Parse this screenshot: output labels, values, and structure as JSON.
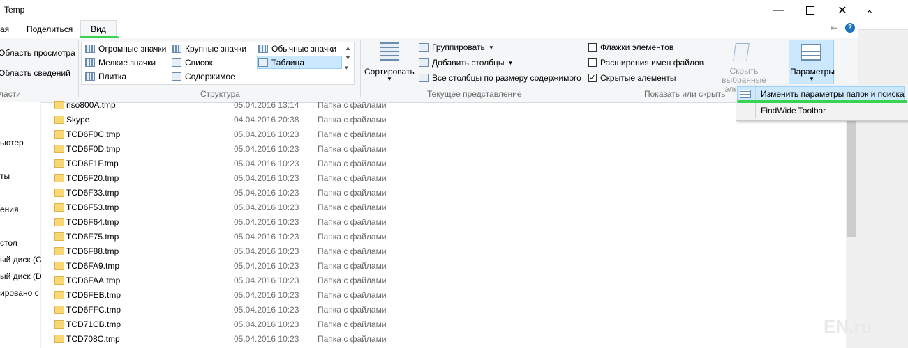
{
  "window": {
    "title": "Temp"
  },
  "tabs": {
    "left_partial": "ая",
    "share": "Поделиться",
    "view": "Вид"
  },
  "ribbon": {
    "panes": {
      "preview": "Область просмотра",
      "details": "Область сведений",
      "label": "ласти"
    },
    "layout": {
      "items": [
        "Огромные значки",
        "Крупные значки",
        "Обычные значки",
        "Мелкие значки",
        "Список",
        "Таблица",
        "Плитка",
        "Содержимое"
      ],
      "selected": "Таблица",
      "label": "Структура"
    },
    "current_view": {
      "sort": "Сортировать",
      "group": "Группировать",
      "add_columns": "Добавить столбцы",
      "fit_columns": "Все столбцы по размеру содержимого",
      "label": "Текущее представление"
    },
    "show_hide": {
      "item_checkboxes": "Флажки элементов",
      "extensions": "Расширения имен файлов",
      "hidden_items": "Скрытые элементы",
      "hide_selected_1": "Скрыть выбранные",
      "hide_selected_2": "элементы",
      "label": "Показать или скрыть",
      "checked": {
        "item_checkboxes": false,
        "extensions": false,
        "hidden_items": true
      }
    },
    "options": "Параметры"
  },
  "dropdown": {
    "items": [
      "Изменить параметры папок и поиска",
      "FindWide Toolbar"
    ]
  },
  "nav": [
    "ьютер",
    "ты",
    "ения",
    "стол",
    "ый диск (C",
    "ый диск (D",
    "ировано с"
  ],
  "files": [
    {
      "name": "nso800A.tmp",
      "date": "05.04.2016 13:14",
      "type": "Папка с файлами"
    },
    {
      "name": "Skype",
      "date": "04.04.2016 20:38",
      "type": "Папка с файлами"
    },
    {
      "name": "TCD6F0C.tmp",
      "date": "05.04.2016 10:23",
      "type": "Папка с файлами"
    },
    {
      "name": "TCD6F0D.tmp",
      "date": "05.04.2016 10:23",
      "type": "Папка с файлами"
    },
    {
      "name": "TCD6F1F.tmp",
      "date": "05.04.2016 10:23",
      "type": "Папка с файлами"
    },
    {
      "name": "TCD6F20.tmp",
      "date": "05.04.2016 10:23",
      "type": "Папка с файлами"
    },
    {
      "name": "TCD6F33.tmp",
      "date": "05.04.2016 10:23",
      "type": "Папка с файлами"
    },
    {
      "name": "TCD6F53.tmp",
      "date": "05.04.2016 10:23",
      "type": "Папка с файлами"
    },
    {
      "name": "TCD6F64.tmp",
      "date": "05.04.2016 10:23",
      "type": "Папка с файлами"
    },
    {
      "name": "TCD6F75.tmp",
      "date": "05.04.2016 10:23",
      "type": "Папка с файлами"
    },
    {
      "name": "TCD6F88.tmp",
      "date": "05.04.2016 10:23",
      "type": "Папка с файлами"
    },
    {
      "name": "TCD6FA9.tmp",
      "date": "05.04.2016 10:23",
      "type": "Папка с файлами"
    },
    {
      "name": "TCD6FAA.tmp",
      "date": "05.04.2016 10:23",
      "type": "Папка с файлами"
    },
    {
      "name": "TCD6FEB.tmp",
      "date": "05.04.2016 10:23",
      "type": "Папка с файлами"
    },
    {
      "name": "TCD6FFC.tmp",
      "date": "05.04.2016 10:23",
      "type": "Папка с файлами"
    },
    {
      "name": "TCD71CB.tmp",
      "date": "05.04.2016 10:23",
      "type": "Папка с файлами"
    },
    {
      "name": "TCD708C.tmp",
      "date": "05.04.2016 10:23",
      "type": "Папка с файлами"
    }
  ],
  "watermark": "EN.ru",
  "colors": {
    "accent_green": "#39d353",
    "selection": "#cce8ff",
    "folder": "#f8d775"
  }
}
